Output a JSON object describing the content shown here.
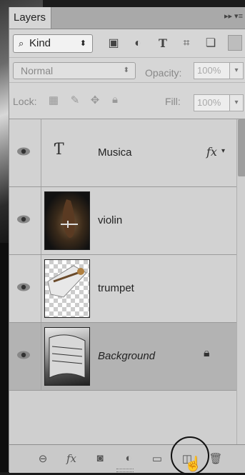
{
  "panel": {
    "tab_title": "Layers",
    "tab_menu_glyphs": "▸▸  ▾≡"
  },
  "filter": {
    "kind_label": "Kind",
    "kind_arrow": "⬍",
    "icons": [
      "image-icon",
      "adjustment-icon",
      "type-icon",
      "shape-icon",
      "smart-object-icon"
    ]
  },
  "blend": {
    "mode": "Normal",
    "opacity_label": "Opacity:",
    "opacity_value": "100%"
  },
  "lock": {
    "label": "Lock:",
    "fill_label": "Fill:",
    "fill_value": "100%"
  },
  "layers": [
    {
      "name": "Musica",
      "type": "text",
      "has_fx": true,
      "fx_label": "fx",
      "locked": false,
      "selected": false
    },
    {
      "name": "violin",
      "type": "image",
      "has_fx": false,
      "locked": false,
      "selected": false
    },
    {
      "name": "trumpet",
      "type": "image",
      "has_fx": false,
      "locked": false,
      "selected": false
    },
    {
      "name": "Background",
      "type": "image",
      "has_fx": false,
      "locked": true,
      "selected": true
    }
  ],
  "toolbar": {
    "fx_label": "fx",
    "icons": [
      "link-layers-icon",
      "fx-icon",
      "add-mask-icon",
      "adjustment-layer-icon",
      "new-group-icon",
      "new-layer-icon",
      "delete-layer-icon"
    ]
  }
}
